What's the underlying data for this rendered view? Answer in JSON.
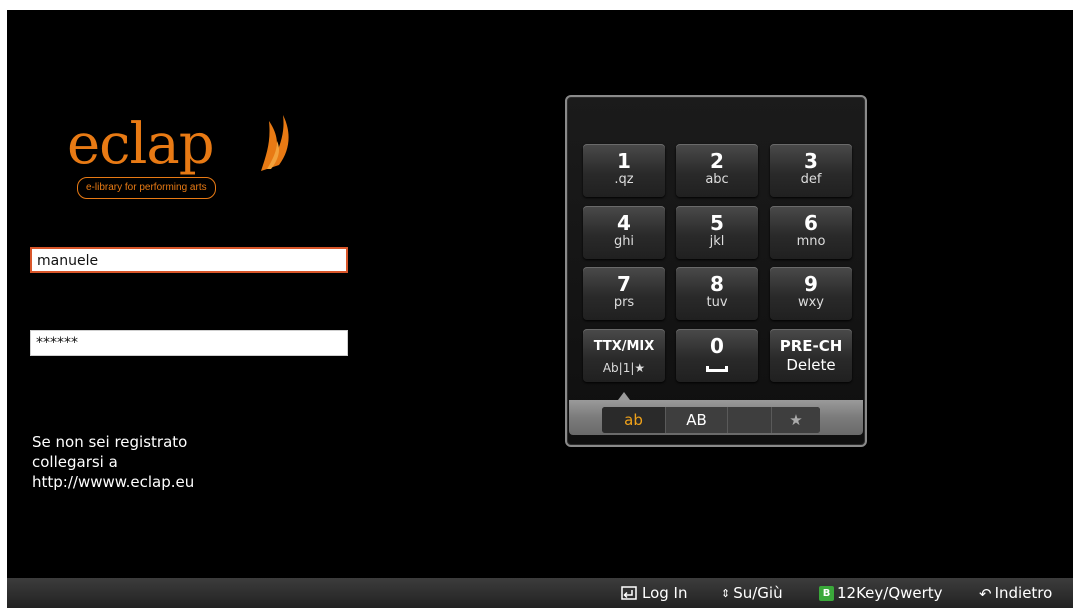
{
  "logo": {
    "word": "eclap",
    "tagline": "e-library for performing arts",
    "color": "#e87a14"
  },
  "login": {
    "username_value": "manuele",
    "password_value": "******"
  },
  "info": {
    "line1": "Se non sei registrato",
    "line2": "collegarsi a",
    "line3": "http://wwww.eclap.eu"
  },
  "keypad": {
    "keys": [
      {
        "num": "1",
        "sub": ".qz"
      },
      {
        "num": "2",
        "sub": "abc"
      },
      {
        "num": "3",
        "sub": "def"
      },
      {
        "num": "4",
        "sub": "ghi"
      },
      {
        "num": "5",
        "sub": "jkl"
      },
      {
        "num": "6",
        "sub": "mno"
      },
      {
        "num": "7",
        "sub": "prs"
      },
      {
        "num": "8",
        "sub": "tuv"
      },
      {
        "num": "9",
        "sub": "wxy"
      },
      {
        "num": "TTX/MIX",
        "sub": "Ab|1|★"
      },
      {
        "num": "0",
        "sub": "space-icon"
      },
      {
        "num": "PRE-CH",
        "sub": "Delete"
      }
    ],
    "modes": {
      "lower": "ab",
      "upper": "AB",
      "symbols": "★"
    },
    "active_mode_color": "#f0a21a"
  },
  "footer": {
    "login": "Log In",
    "updown": "Su/Giù",
    "b_badge": "B",
    "keymode": "12Key/Qwerty",
    "back": "Indietro",
    "b_badge_color": "#3aa83a"
  }
}
